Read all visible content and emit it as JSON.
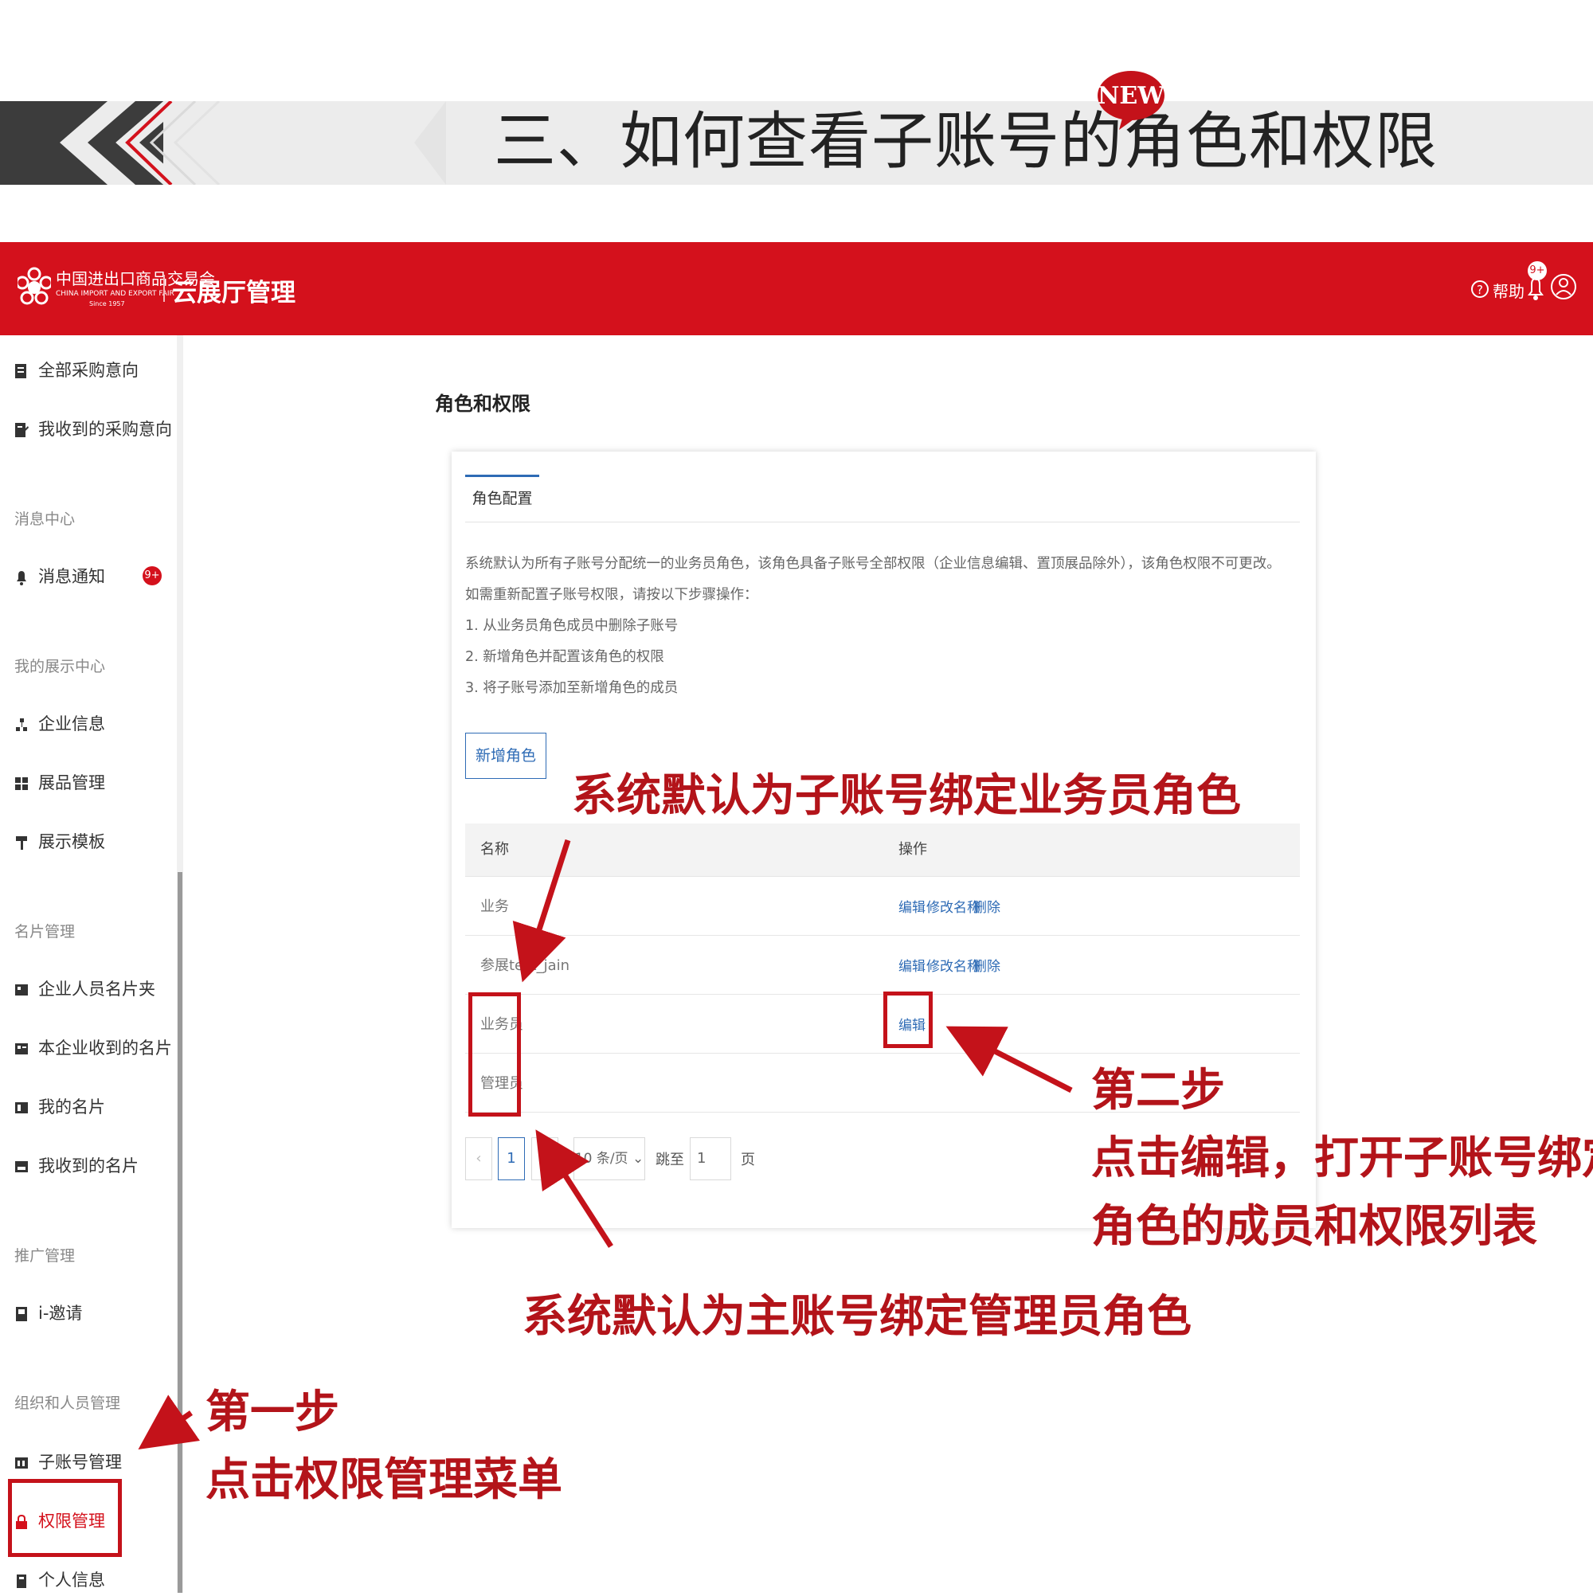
{
  "banner": {
    "title": "三、如何查看子账号的角色和权限",
    "badge": "NEW"
  },
  "header": {
    "logo_cn": "中国进出口商品交易会",
    "logo_en": "CHINA IMPORT AND EXPORT FAIR",
    "logo_since": "Since 1957",
    "app_name": "云展厅管理",
    "help_label": "帮助",
    "bell_badge": "9+"
  },
  "sidebar": {
    "items": [
      {
        "label": "全部采购意向",
        "icon": "document-icon"
      },
      {
        "label": "我收到的采购意向",
        "icon": "document-edit-icon"
      },
      {
        "section": "消息中心"
      },
      {
        "label": "消息通知",
        "icon": "bell-icon",
        "badge": "9+"
      },
      {
        "section": "我的展示中心"
      },
      {
        "label": "企业信息",
        "icon": "org-icon"
      },
      {
        "label": "展品管理",
        "icon": "grid-icon"
      },
      {
        "label": "展示模板",
        "icon": "brush-icon"
      },
      {
        "section": "名片管理"
      },
      {
        "label": "企业人员名片夹",
        "icon": "card-folder-icon"
      },
      {
        "label": "本企业收到的名片",
        "icon": "card-received-icon"
      },
      {
        "label": "我的名片",
        "icon": "card-icon"
      },
      {
        "label": "我收到的名片",
        "icon": "card-inbox-icon"
      },
      {
        "section": "推广管理"
      },
      {
        "label": "i-邀请",
        "icon": "invite-icon"
      },
      {
        "section": "组织和人员管理"
      },
      {
        "label": "子账号管理",
        "icon": "sub-account-icon"
      },
      {
        "label": "权限管理",
        "icon": "lock-icon",
        "active": true
      },
      {
        "label": "个人信息",
        "icon": "person-icon"
      }
    ]
  },
  "main": {
    "page_title": "角色和权限",
    "tab": "角色配置",
    "description": [
      "系统默认为所有子账号分配统一的业务员角色，该角色具备子账号全部权限（企业信息编辑、置顶展品除外），该角色权限不可更改。",
      "如需重新配置子账号权限，请按以下步骤操作：",
      "1. 从业务员角色成员中删除子账号",
      "2. 新增角色并配置该角色的权限",
      "3. 将子账号添加至新增角色的成员"
    ],
    "add_button": "新增角色",
    "table": {
      "headers": [
        "名称",
        "操作"
      ],
      "rows": [
        {
          "name": "业务",
          "ops": [
            "编辑",
            "修改名称",
            "删除"
          ]
        },
        {
          "name": "参展test_jain",
          "ops": [
            "编辑",
            "修改名称",
            "删除"
          ]
        },
        {
          "name": "业务员",
          "ops": [
            "编辑"
          ]
        },
        {
          "name": "管理员",
          "ops": []
        }
      ]
    },
    "pagination": {
      "prev": "‹",
      "current": "1",
      "next": "›",
      "page_size": "10 条/页",
      "jump_label": "跳至",
      "jump_value": "1",
      "page_suffix": "页"
    }
  },
  "annotations": {
    "sub_default": "系统默认为子账号绑定业务员角色",
    "main_default": "系统默认为主账号绑定管理员角色",
    "step2_title": "第二步",
    "step2_line1": "点击编辑，打开子账号绑定",
    "step2_line2": "角色的成员和权限列表",
    "step1_title": "第一步",
    "step1_line1": "点击权限管理菜单"
  },
  "colors": {
    "brand_red": "#d4111c",
    "annotation_red": "#b3141a",
    "link_blue": "#2e6bb5"
  }
}
